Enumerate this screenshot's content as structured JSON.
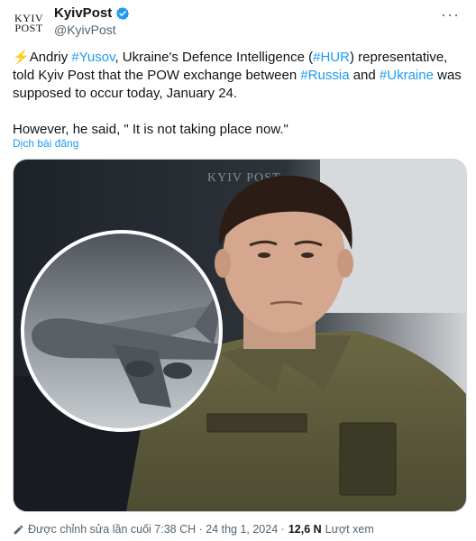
{
  "author": {
    "avatar_line1": "KYIV",
    "avatar_line2": "POST",
    "display_name": "KyivPost",
    "handle": "@KyivPost"
  },
  "tweet": {
    "emoji": "⚡",
    "seg1": "Andriy ",
    "tag_yusov": "#Yusov",
    "seg2": ", Ukraine's Defence Intelligence (",
    "tag_hur": "#HUR",
    "seg3": ") representative, told Kyiv Post that the POW exchange between ",
    "tag_russia": "#Russia",
    "seg4": " and ",
    "tag_ukraine": "#Ukraine",
    "seg5": " was supposed to occur today, January 24.",
    "paragraph2": "However, he said, \" It is not taking place now.\"",
    "translate_label": "Dịch bài đăng"
  },
  "media": {
    "watermark": "KYIV POST"
  },
  "footer": {
    "edited_label": "Được chỉnh sửa lần cuối 7:38 CH · 24 thg 1, 2024 · ",
    "views_count": "12,6 N",
    "views_label": "Lượt xem"
  },
  "colors": {
    "link": "#1d9bf0",
    "text": "#0f1419",
    "muted": "#536471",
    "uniform": "#5a5a3a"
  }
}
